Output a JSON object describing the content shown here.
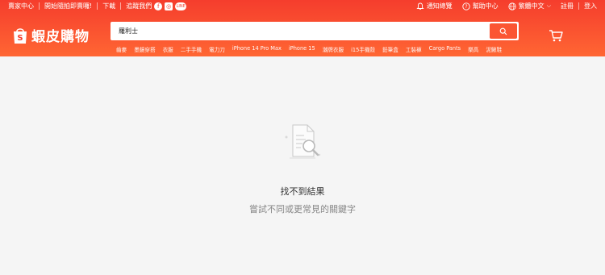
{
  "topbar": {
    "left_links": [
      "賣家中心",
      "開始隨拍即賣囉!",
      "下載",
      "追蹤我們"
    ],
    "social_icons": [
      "facebook-icon",
      "instagram-icon",
      "line-icon"
    ],
    "notifications": "通知總覽",
    "help": "幫助中心",
    "language": "繁體中文",
    "register": "註冊",
    "login": "登入"
  },
  "header": {
    "brand": "蝦皮購物",
    "search_value": "羅利士",
    "hints": [
      "齒麥",
      "墨鏡穿搭",
      "衣服",
      "二手手機",
      "電力刀",
      "iPhone 14 Pro Max",
      "iPhone 15",
      "潮牌衣服",
      "i15手機殼",
      "鉛筆盒",
      "工裝褲",
      "Cargo Pants",
      "樂高",
      "泥鰍鞋"
    ]
  },
  "empty_state": {
    "title": "找不到結果",
    "subtitle": "嘗試不同或更常見的關鍵字"
  },
  "colors": {
    "brand": "#f53d2d",
    "brand_end": "#ff6633",
    "background": "#f5f5f5"
  }
}
